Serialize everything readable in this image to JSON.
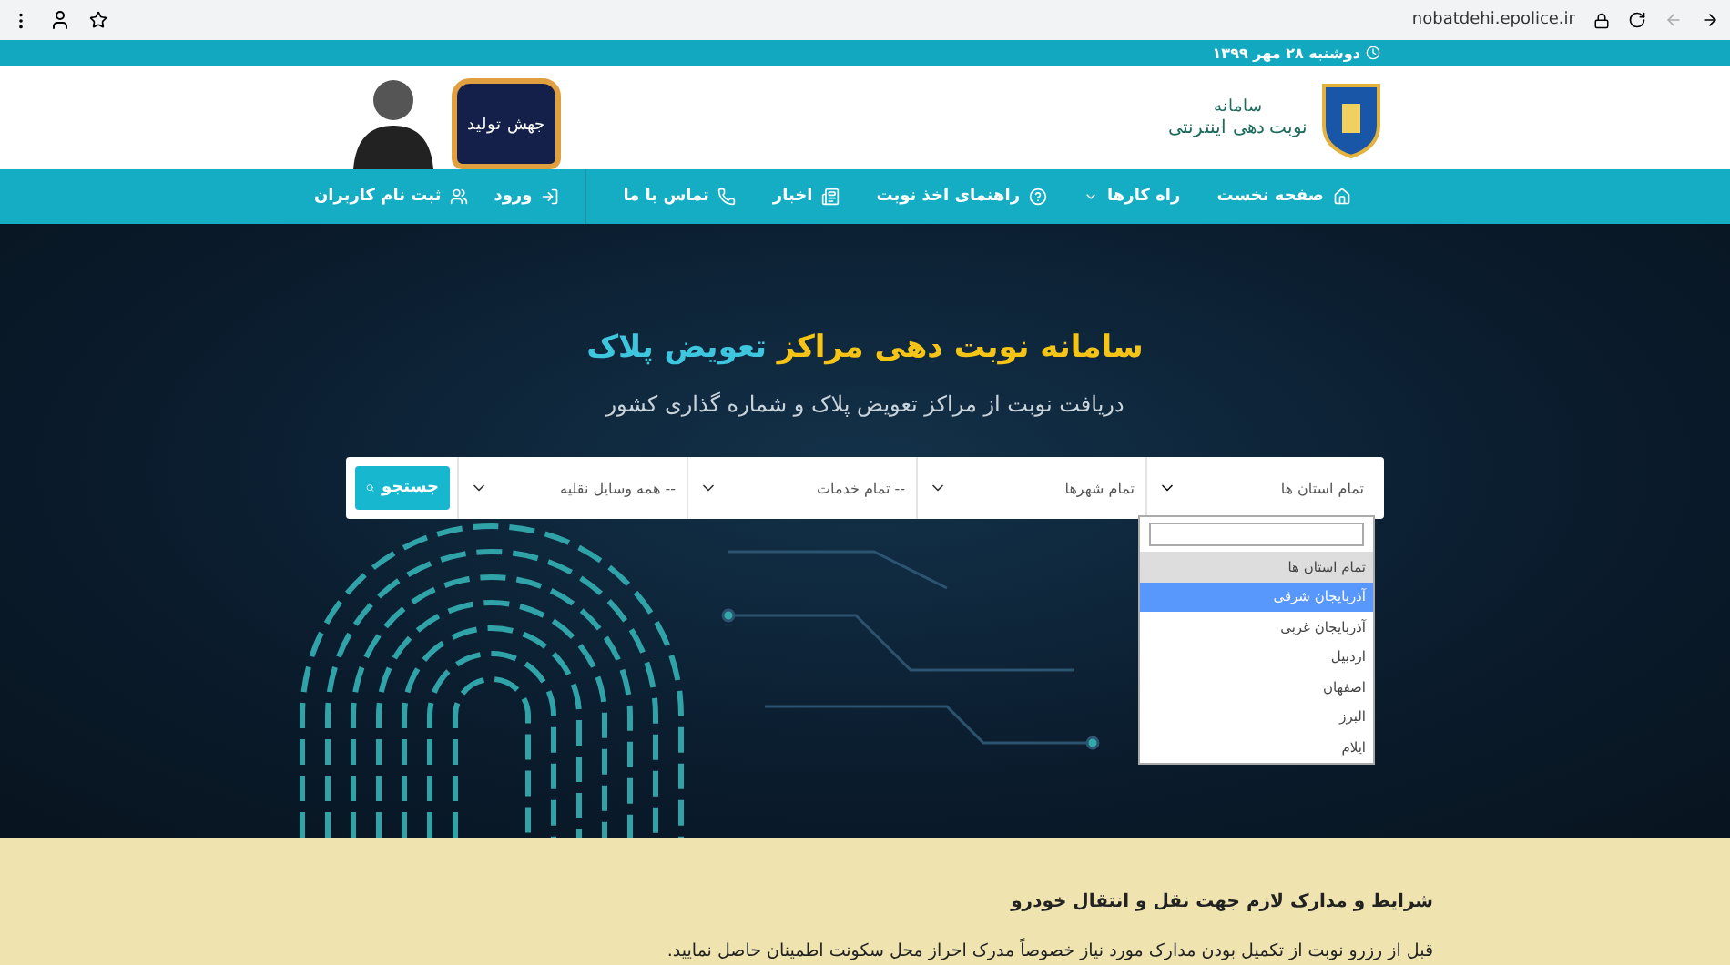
{
  "browser": {
    "url": "nobatdehi.epolice.ir"
  },
  "top_strip": {
    "date": "دوشنبه ۲۸ مهر ۱۳۹۹"
  },
  "header": {
    "logo_title": "سامانه",
    "logo_subtitle": "نوبت دهی اینترنتی",
    "badge_text": "جهش تولید"
  },
  "nav": {
    "items": [
      {
        "label": "صفحه نخست",
        "has_caret": false
      },
      {
        "label": "راه کارها",
        "has_caret": true
      },
      {
        "label": "راهنمای اخذ نوبت",
        "has_caret": false
      },
      {
        "label": "اخبار",
        "has_caret": false
      },
      {
        "label": "تماس با ما",
        "has_caret": false
      }
    ],
    "user_items": [
      {
        "label": "ورود"
      },
      {
        "label": "ثبت نام کاربران"
      }
    ]
  },
  "hero": {
    "title_part1": "سامانه نوبت دهی مراکز",
    "title_part2": "تعویض پلاک",
    "subtitle": "دریافت نوبت از مراکز تعویض پلاک و شماره گذاری کشور"
  },
  "search": {
    "selects": [
      {
        "value": "تمام استان ها",
        "expanded": true
      },
      {
        "value": "تمام شهرها",
        "expanded": false
      },
      {
        "value": "-- تمام خدمات",
        "expanded": false
      },
      {
        "value": "-- همه وسایل نقلیه",
        "expanded": false
      }
    ],
    "button": "جستجو",
    "dropdown": {
      "options": [
        {
          "label": "تمام استان ها",
          "selected": true,
          "hovered": false
        },
        {
          "label": "آذربایجان شرقی",
          "selected": false,
          "hovered": true
        },
        {
          "label": "آذربایجان غربی",
          "selected": false,
          "hovered": false
        },
        {
          "label": "اردبیل",
          "selected": false,
          "hovered": false
        },
        {
          "label": "اصفهان",
          "selected": false,
          "hovered": false
        },
        {
          "label": "البرز",
          "selected": false,
          "hovered": false
        },
        {
          "label": "ایلام",
          "selected": false,
          "hovered": false
        }
      ]
    }
  },
  "info": {
    "heading": "شرایط و مدارک لازم جهت نقل و انتقال خودرو",
    "text": "قبل از رزرو نوبت از تکمیل بودن مدارک مورد نیاز خصوصاً مدرک احراز محل سکونت اطمینان حاصل نمایید."
  }
}
